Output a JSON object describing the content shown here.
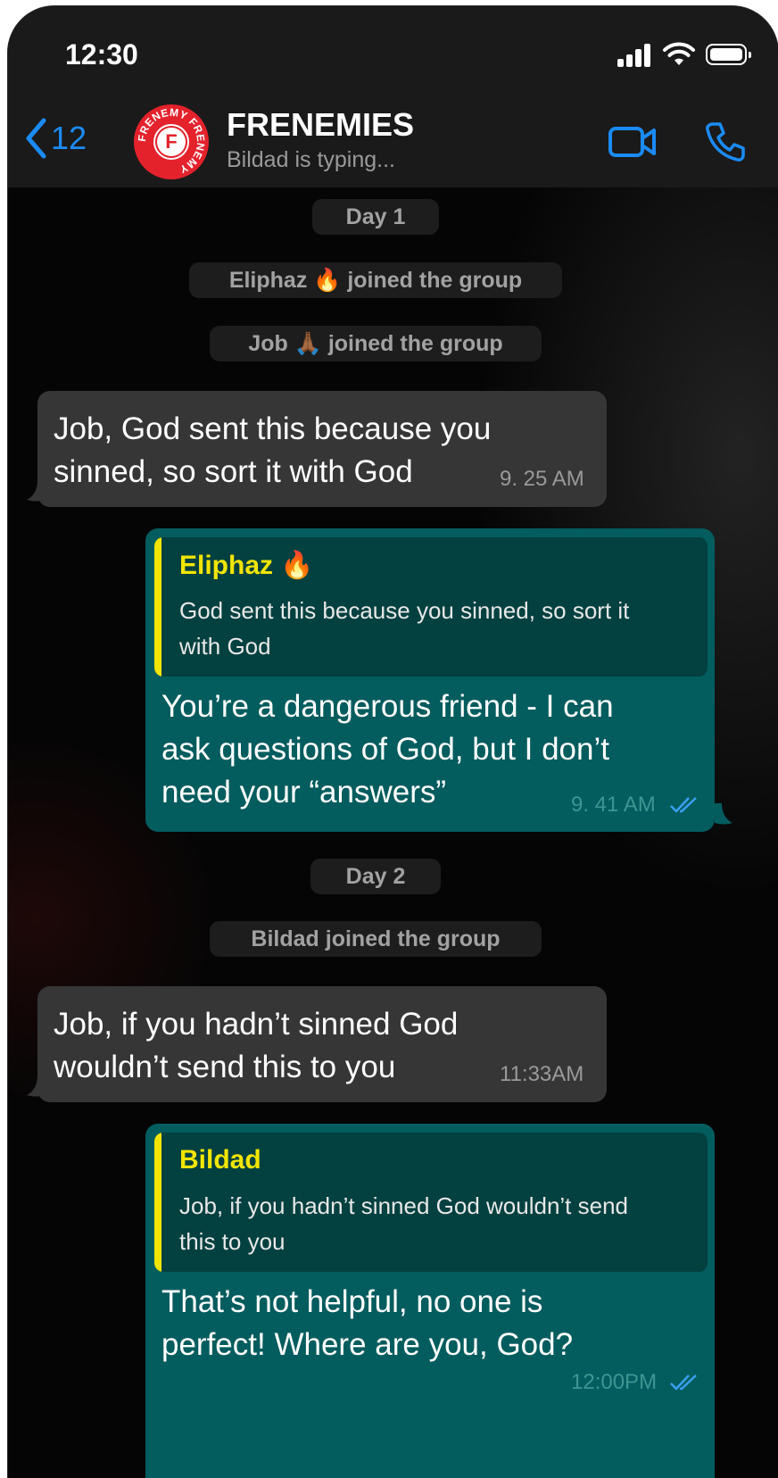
{
  "status_bar": {
    "time": "12:30"
  },
  "header": {
    "back_count": "12",
    "avatar_letter": "F",
    "avatar_ring_text": "FRENEMY FRENEMY",
    "group_name": "FRENEMIES",
    "subtitle": "Bildad is typing..."
  },
  "chat": {
    "day1": "Day 1",
    "event1": "Eliphaz 🔥 joined the group",
    "event2": "Job 🙏🏾 joined the group",
    "msg1": {
      "line1": "Job, God sent this because you",
      "line2": "sinned, so sort it with God",
      "time": "9. 25 AM"
    },
    "msg2": {
      "quote_author": "Eliphaz 🔥",
      "quote_line1": "God sent this because you sinned, so sort it",
      "quote_line2": "with God",
      "line1": "You’re a dangerous friend - I can",
      "line2": "ask questions of God, but I don’t",
      "line3": "need your “answers”",
      "time": "9. 41 AM"
    },
    "day2": "Day 2",
    "event3": "Bildad joined the group",
    "msg3": {
      "line1": "Job, if you hadn’t sinned God",
      "line2": "wouldn’t send this to you",
      "time": "11:33AM"
    },
    "msg4": {
      "quote_author": "Bildad",
      "quote_line1": "Job, if you hadn’t sinned God wouldn’t send",
      "quote_line2": "this to you",
      "line1": "That’s not helpful, no one is",
      "line2": "perfect! Where are you, God?",
      "time": "12:00PM"
    }
  },
  "colors": {
    "accent_blue": "#1b8bf5",
    "incoming_bubble": "#363636",
    "outgoing_bubble": "#035c5e",
    "quote_author": "#f2e503",
    "read_ticks": "#3aa0f0"
  },
  "icons": [
    "back-chevron-icon",
    "video-call-icon",
    "phone-call-icon",
    "signal-icon",
    "wifi-icon",
    "battery-icon",
    "read-receipt-icon"
  ]
}
